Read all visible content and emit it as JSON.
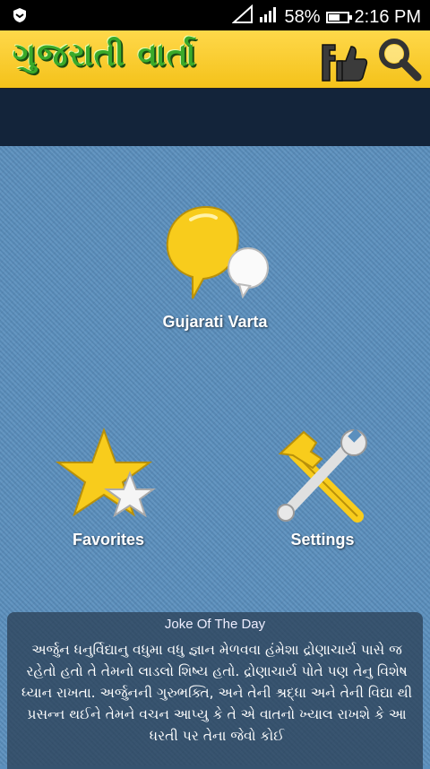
{
  "status_bar": {
    "battery_percent": "58%",
    "battery_level": 0.58,
    "time": "2:16 PM",
    "icons": [
      "shield-icon",
      "signal-icon",
      "battery-icon"
    ]
  },
  "app_bar": {
    "title": "ગુજરાતી વાર્તા",
    "actions": [
      "facebook-like-icon",
      "search-icon"
    ]
  },
  "menu": {
    "varta_label": "Gujarati Varta",
    "favorites_label": "Favorites",
    "settings_label": "Settings"
  },
  "joke": {
    "title": "Joke Of The Day",
    "text": "અર્જુન ધનુર્વિદ્યાનુ વધુમા વધુ જ્ઞાન મેળવવા હંમેશા દ્રોણાચાર્ય પાસે જ રહેતો હતો તે તેમનો લાડલો શિષ્ય હતો. દ્રોણાચાર્ય પોતે પણ તેનુ વિશેષ ધ્યાન રાખતા. અર્જુનની ગુરુભક્તિ, અને તેની શ્રદ્ધા અને તેની વિદ્યા થી પ્રસન્ન થઈને તેમને વચન આપ્યુ કે તે એ વાતનો ખ્યાલ રાખશે કે આ ધરતી પર તેના જેવો કોઈ"
  },
  "colors": {
    "app_bar": "#f4c21a",
    "title_green": "#3aaa2a",
    "sub_bar": "#13243a",
    "denim": "#5b8fbd"
  }
}
